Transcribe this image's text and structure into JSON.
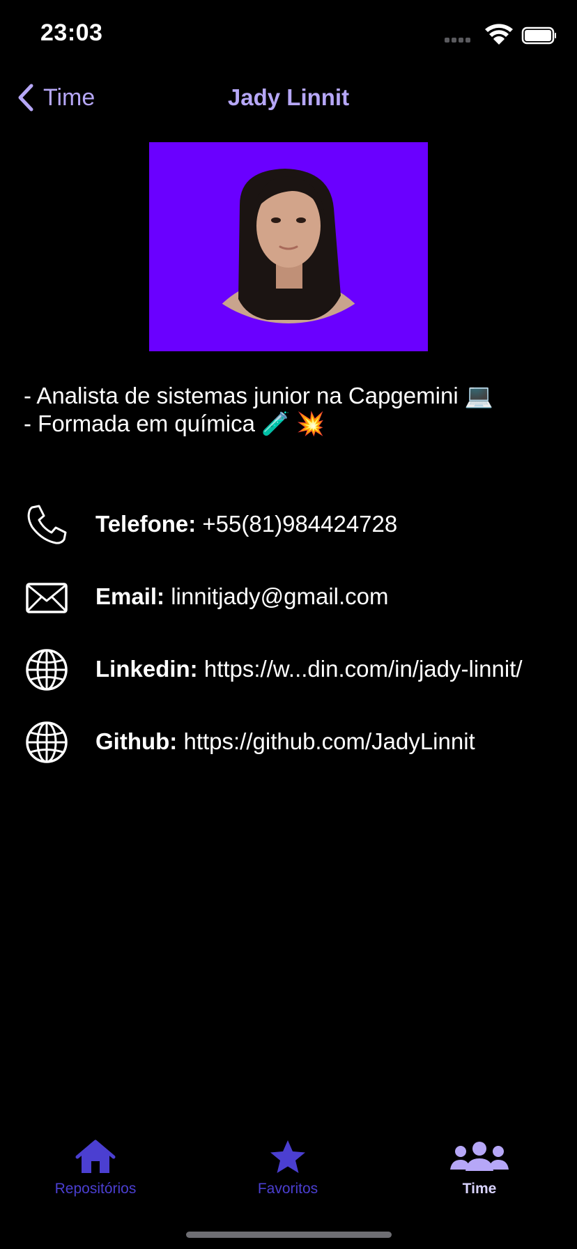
{
  "status_bar": {
    "time": "23:03"
  },
  "nav": {
    "back_label": "Time",
    "title": "Jady Linnit"
  },
  "bio": [
    "- Analista de sistemas junior na Capgemini 💻",
    "- Formada em química 🧪 💥"
  ],
  "contacts": [
    {
      "icon": "phone-icon",
      "label": "Telefone:",
      "value": "+55(81)984424728"
    },
    {
      "icon": "mail-icon",
      "label": "Email:",
      "value": "linnitjady@gmail.com"
    },
    {
      "icon": "globe-icon",
      "label": "Linkedin:",
      "value": "https://w...din.com/in/jady-linnit/"
    },
    {
      "icon": "globe-icon",
      "label": "Github:",
      "value": "https://github.com/JadyLinnit"
    }
  ],
  "tabs": [
    {
      "label": "Repositórios",
      "icon": "house-icon",
      "active": false
    },
    {
      "label": "Favoritos",
      "icon": "star-icon",
      "active": false
    },
    {
      "label": "Time",
      "icon": "people-icon",
      "active": true
    }
  ],
  "colors": {
    "accent": "#b6a7f7",
    "tab_inactive": "#4b3fd1",
    "photo_background": "#6a00ff",
    "background": "#000000"
  }
}
